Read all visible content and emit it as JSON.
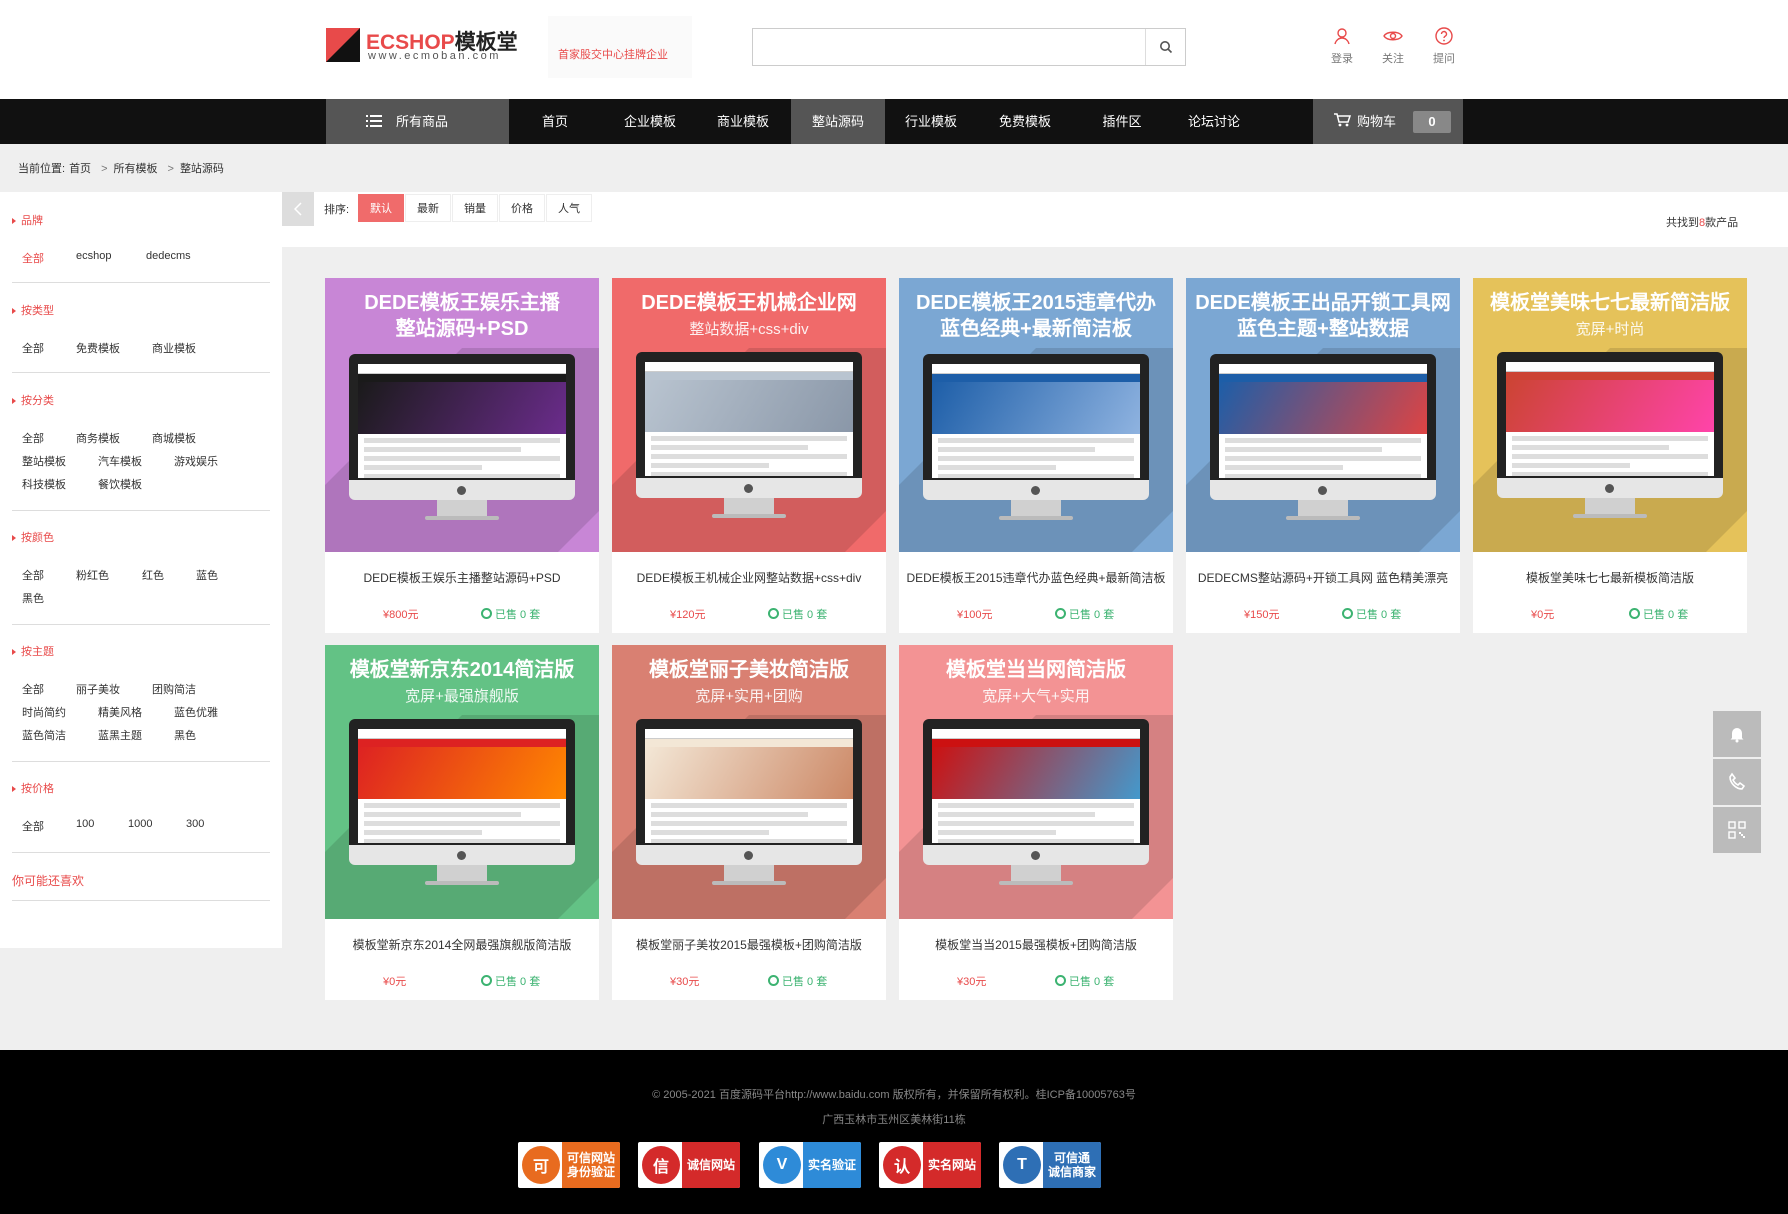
{
  "header": {
    "logo_brand_red": "ECSHOP",
    "logo_brand_dark": "模板堂",
    "logo_url": "www.ecmoban.com",
    "slogan": "首家股交中心挂牌企业",
    "search_placeholder": "",
    "icons": [
      {
        "name": "user-icon",
        "label": "登录"
      },
      {
        "name": "eye-icon",
        "label": "关注"
      },
      {
        "name": "help-icon",
        "label": "提问"
      }
    ]
  },
  "nav": {
    "all_categories": "所有商品",
    "items": [
      "首页",
      "企业模板",
      "商业模板",
      "整站源码",
      "行业模板",
      "免费模板",
      "插件区",
      "论坛讨论"
    ],
    "active": "整站源码",
    "cart_label": "购物车",
    "cart_count": "0"
  },
  "breadcrumb": {
    "prefix": "当前位置:",
    "items": [
      "首页",
      "所有模板",
      "整站源码"
    ]
  },
  "sidebar": {
    "groups": [
      {
        "title": "品牌",
        "options": [
          "全部",
          "ecshop",
          "dedecms"
        ]
      },
      {
        "title": "按类型",
        "options": [
          "全部",
          "免费模板",
          "商业模板"
        ]
      },
      {
        "title": "按分类",
        "options": [
          "全部",
          "商务模板",
          "商城模板",
          "整站模板",
          "汽车模板",
          "游戏娱乐",
          "科技模板",
          "餐饮模板"
        ]
      },
      {
        "title": "按颜色",
        "options": [
          "全部",
          "粉红色",
          "红色",
          "蓝色",
          "黑色"
        ]
      },
      {
        "title": "按主题",
        "options": [
          "全部",
          "丽子美妆",
          "团购简洁",
          "时尚简约",
          "精美风格",
          "蓝色优雅",
          "蓝色简洁",
          "蓝黑主题",
          "黑色"
        ]
      },
      {
        "title": "按价格",
        "options": [
          "全部",
          "100",
          "1000",
          "300"
        ]
      }
    ],
    "may_like": "你可能还喜欢"
  },
  "sort": {
    "label": "排序:",
    "options": [
      "默认",
      "最新",
      "销量",
      "价格",
      "人气"
    ],
    "active": "默认",
    "total_prefix": "共找到",
    "total_count": "8",
    "total_suffix": "款产品"
  },
  "products": [
    {
      "banner_title": "DEDE模板王娱乐主播\n整站源码+PSD",
      "banner_sub": "",
      "bg": "#c886d6",
      "name": "DEDE模板王娱乐主播整站源码+PSD",
      "price": "¥800元",
      "sold": "已售 0 套"
    },
    {
      "banner_title": "DEDE模板王机械企业网",
      "banner_sub": "整站数据+css+div",
      "bg": "#f06a6a",
      "name": "DEDE模板王机械企业网整站数据+css+div",
      "price": "¥120元",
      "sold": "已售 0 套"
    },
    {
      "banner_title": "DEDE模板王2015违章代办\n蓝色经典+最新简洁板",
      "banner_sub": "",
      "bg": "#7ba7d3",
      "name": "DEDE模板王2015违章代办蓝色经典+最新简洁板",
      "price": "¥100元",
      "sold": "已售 0 套"
    },
    {
      "banner_title": "DEDE模板王出品开锁工具网\n蓝色主题+整站数据",
      "banner_sub": "",
      "bg": "#7ba7d3",
      "name": "DEDECMS整站源码+开锁工具网 蓝色精美漂亮",
      "price": "¥150元",
      "sold": "已售 0 套"
    },
    {
      "banner_title": "模板堂美味七七最新简洁版",
      "banner_sub": "宽屏+时尚",
      "bg": "#e5c25a",
      "name": "模板堂美味七七最新模板简洁版",
      "price": "¥0元",
      "sold": "已售 0 套"
    },
    {
      "banner_title": "模板堂新京东2014简洁版",
      "banner_sub": "宽屏+最强旗舰版",
      "bg": "#63c285",
      "name": "模板堂新京东2014全网最强旗舰版简洁版",
      "price": "¥0元",
      "sold": "已售 0 套"
    },
    {
      "banner_title": "模板堂丽子美妆简洁版",
      "banner_sub": "宽屏+实用+团购",
      "bg": "#d98072",
      "name": "模板堂丽子美妆2015最强模板+团购简洁版",
      "price": "¥30元",
      "sold": "已售 0 套"
    },
    {
      "banner_title": "模板堂当当网简洁版",
      "banner_sub": "宽屏+大气+实用",
      "bg": "#f39394",
      "name": "模板堂当当2015最强模板+团购简洁版",
      "price": "¥30元",
      "sold": "已售 0 套"
    }
  ],
  "footer": {
    "copyright": "© 2005-2021 百度源码平台http://www.baidu.com 版权所有，并保留所有权利。桂ICP备10005763号",
    "address": "广西玉林市玉州区美林街11栋",
    "badges": [
      {
        "icon": "可",
        "text": "可信网站\n身份验证",
        "color": "#e86b1f"
      },
      {
        "icon": "信",
        "text": "诚信网站",
        "color": "#d42a2a"
      },
      {
        "icon": "V",
        "text": "实名验证",
        "color": "#2e8bd8"
      },
      {
        "icon": "认",
        "text": "实名网站",
        "color": "#d42a2a"
      },
      {
        "icon": "T",
        "text": "可信通\n诚信商家",
        "color": "#2e6fb5"
      }
    ]
  },
  "colors": {
    "accent": "#e84a4a",
    "nav_bg": "#111111",
    "nav_active": "#555555",
    "sold_green": "#3cb371"
  }
}
